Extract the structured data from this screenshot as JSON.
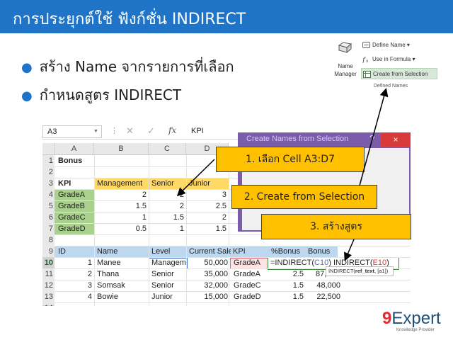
{
  "slide": {
    "title": "การประยุกต์ใช้ ฟังก์ชั่น INDIRECT",
    "bullets": [
      "สร้าง Name จากรายการที่เลือก",
      "กำหนดสูตร INDIRECT"
    ]
  },
  "ribbon": {
    "name_manager_line1": "Name",
    "name_manager_line2": "Manager",
    "define_name": "Define Name ▾",
    "use_in_formula": "Use in Formula ▾",
    "create_from_selection": "Create from Selection",
    "group_label": "Defined Names"
  },
  "excel": {
    "namebox": "A3",
    "formula_value": "KPI",
    "columns": [
      "A",
      "B",
      "C",
      "D"
    ],
    "rows": [
      "1",
      "2",
      "3",
      "4",
      "5",
      "6",
      "7",
      "8",
      "9",
      "10",
      "11",
      "12",
      "13",
      "14"
    ],
    "selected_row": "10",
    "cells": {
      "r1_a": "Bonus",
      "r3": [
        "KPI",
        "Management",
        "Senior",
        "Junior"
      ],
      "r4": [
        "GradeA",
        "2",
        "2",
        "3"
      ],
      "r5": [
        "GradeB",
        "1.5",
        "2",
        "2.5"
      ],
      "r6": [
        "GradeC",
        "1",
        "1.5",
        "2"
      ],
      "r7": [
        "GradeD",
        "0.5",
        "1",
        "1.5"
      ],
      "r9": [
        "ID",
        "Name",
        "Level",
        "Current Sale",
        "KPI",
        "%Bonus",
        "Bonus"
      ],
      "r10": [
        "1",
        "Manee",
        "Managem",
        "50,000",
        "GradeA"
      ],
      "r11": [
        "2",
        "Thana",
        "Senior",
        "35,000",
        "GradeA",
        "2.5",
        "87,5"
      ],
      "r12": [
        "3",
        "Somsak",
        "Senior",
        "32,000",
        "GradeC",
        "1.5",
        "48,000"
      ],
      "r13": [
        "4",
        "Bowie",
        "Junior",
        "15,000",
        "GradeD",
        "1.5",
        "22,500"
      ]
    },
    "formula_parts": [
      "=INDIRECT(",
      "C10",
      ") INDIRECT(",
      "E10",
      ")"
    ],
    "tooltip_fn": "INDIRECT(",
    "tooltip_arg": "ref_text",
    "tooltip_rest": ", [a1])"
  },
  "dialog": {
    "title": "Create Names from Selection",
    "help": "?",
    "close": "×"
  },
  "callouts": {
    "step1": "1. เลือก Cell A3:D7",
    "step2": "2. Create from Selection",
    "step3": "3. สร้างสูตร"
  },
  "logo": {
    "number": "9",
    "word": "Expert",
    "tagline": "Knowledge Provider"
  },
  "colors": {
    "title_bar": "#1f74c8",
    "callout": "#ffc000",
    "header_fill": "#ffd966",
    "kpi_fill": "#a9d08e",
    "table_header_fill": "#bdd7ee",
    "dialog": "#7b5cab"
  }
}
